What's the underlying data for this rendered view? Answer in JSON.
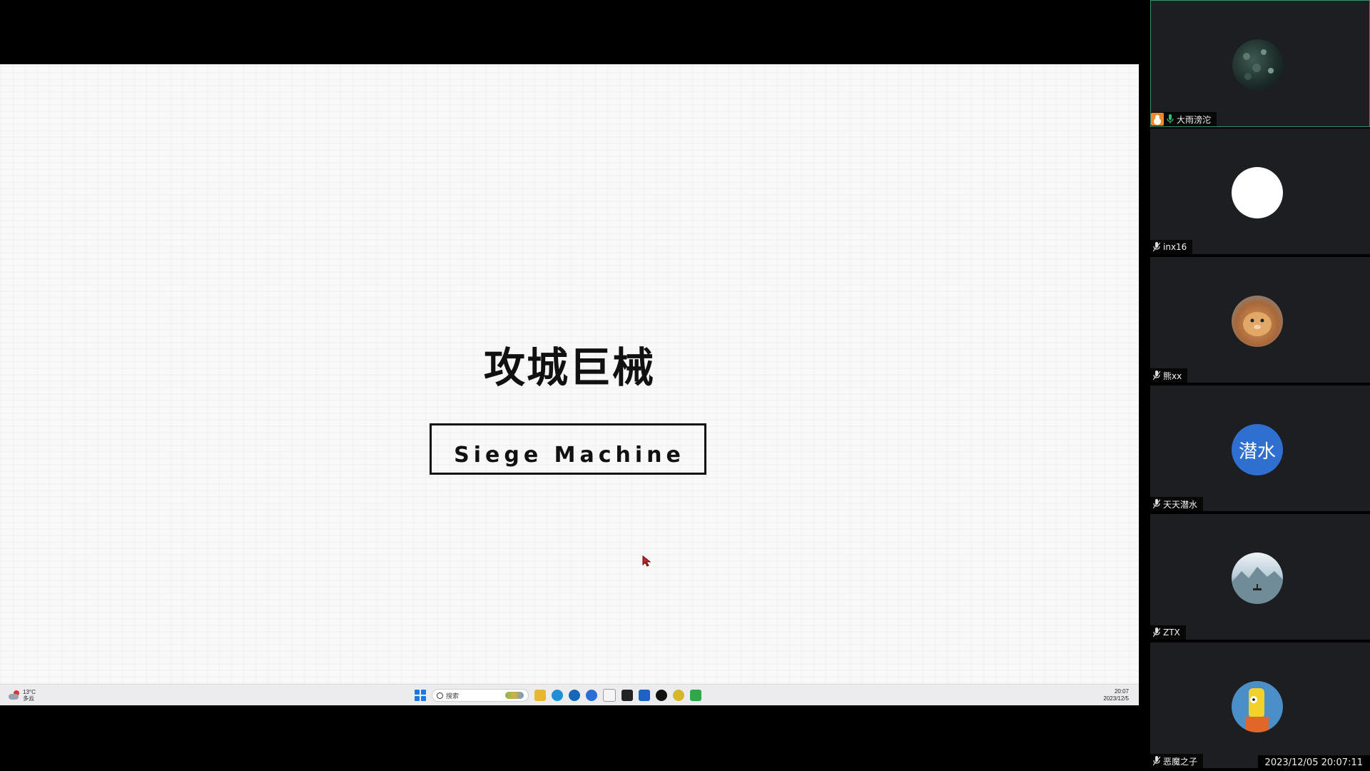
{
  "slide": {
    "title_cn": "攻城巨械",
    "title_en": "Siege Machine"
  },
  "taskbar": {
    "weather_temp": "13°C",
    "weather_desc": "多云",
    "search_placeholder": "搜索",
    "clock_time": "20:07",
    "clock_date": "2023/12/5",
    "apps": [
      "file-explorer",
      "edge",
      "edge-dev",
      "firefox",
      "calendar",
      "app-dark",
      "app-blue",
      "qq",
      "app-yellow",
      "app-green"
    ]
  },
  "participants": [
    {
      "name": "大雨滂沱",
      "avatar": "dark-texture-photo",
      "host": true,
      "mic": "on",
      "active": true
    },
    {
      "name": "inx16",
      "avatar": "white-circle",
      "host": false,
      "mic": "muted",
      "active": false
    },
    {
      "name": "熊xx",
      "avatar": "hamster-photo",
      "host": false,
      "mic": "muted",
      "active": false
    },
    {
      "name": "天天潜水",
      "avatar_text": "潜水",
      "avatar_color": "#2f6fd0",
      "host": false,
      "mic": "muted",
      "active": false
    },
    {
      "name": "ZTX",
      "avatar": "landscape-photo",
      "host": false,
      "mic": "muted",
      "active": false
    },
    {
      "name": "恶魔之子",
      "avatar": "cartoon-photo",
      "host": false,
      "mic": "muted",
      "active": false
    }
  ],
  "timestamp": "2023/12/05 20:07:11",
  "colors": {
    "panel_bg": "#1c1e21",
    "active_border": "#3f8f6a",
    "host_badge": "#f08a24",
    "mic_on": "#2fbf71"
  }
}
